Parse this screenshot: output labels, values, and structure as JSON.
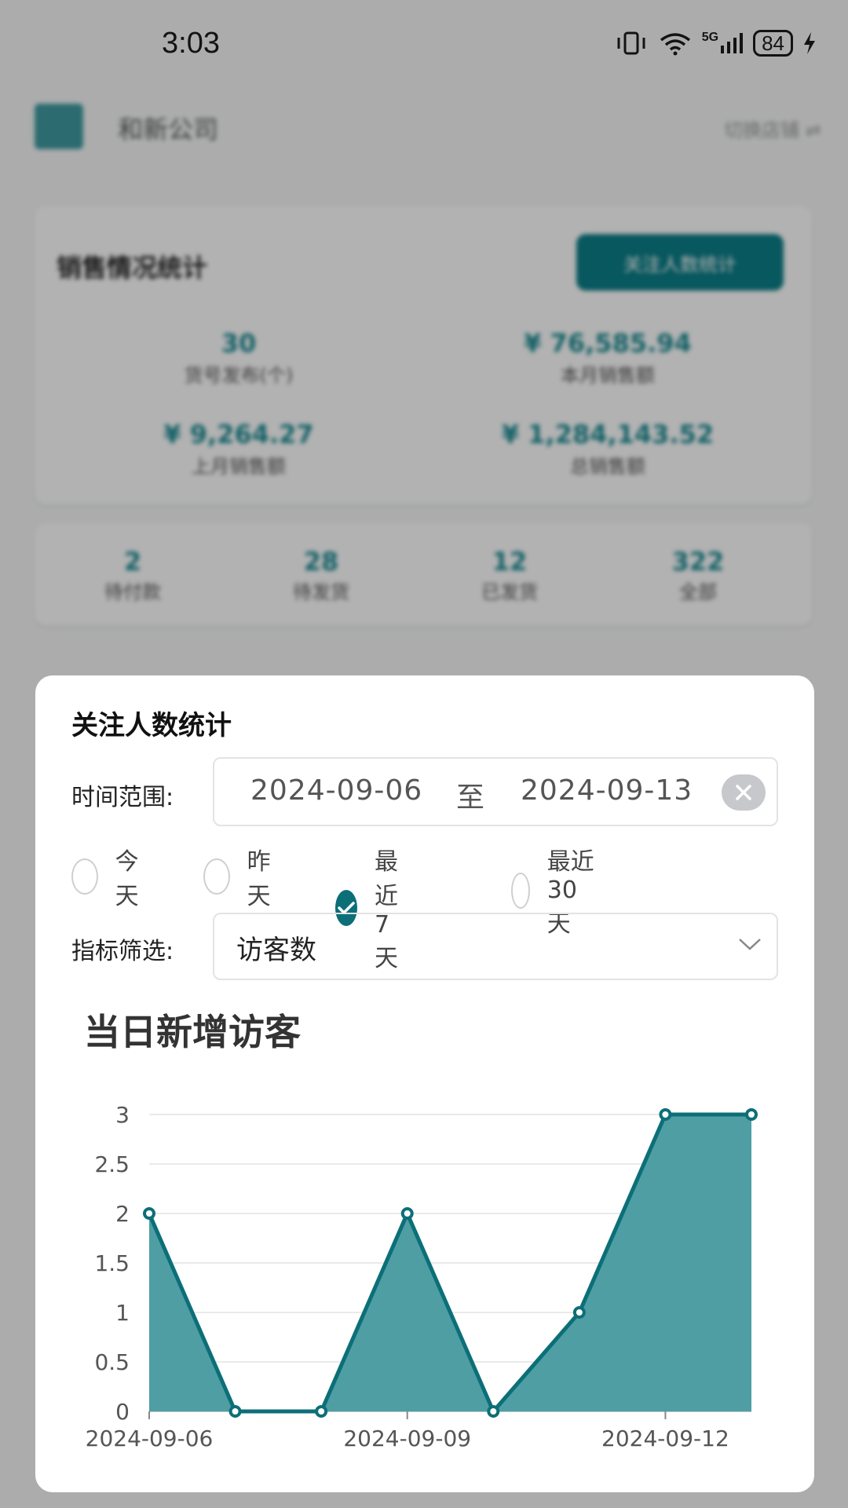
{
  "status_bar": {
    "time": "3:03",
    "battery": "84",
    "network": "5G"
  },
  "background": {
    "company_name": "和新公司",
    "header_right": "切换店铺 ⇌",
    "sales_card": {
      "title": "销售情况统计",
      "button": "关注人数统计",
      "stats": [
        {
          "value": "30",
          "label": "货号发布(个)"
        },
        {
          "value": "¥ 76,585.94",
          "label": "本月销售额"
        },
        {
          "value": "¥ 9,264.27",
          "label": "上月销售额"
        },
        {
          "value": "¥ 1,284,143.52",
          "label": "总销售额"
        }
      ]
    },
    "order_card": {
      "stats": [
        {
          "value": "2",
          "label": "待付款"
        },
        {
          "value": "28",
          "label": "待发货"
        },
        {
          "value": "12",
          "label": "已发货"
        },
        {
          "value": "322",
          "label": "全部"
        }
      ]
    }
  },
  "modal": {
    "title": "关注人数统计",
    "time_range_label": "时间范围:",
    "date_start": "2024-09-06",
    "date_to": "至",
    "date_end": "2024-09-13",
    "quick_ranges": [
      {
        "label": "今天",
        "checked": false
      },
      {
        "label": "昨天",
        "checked": false
      },
      {
        "label": "最近7天",
        "checked": true
      },
      {
        "label": "最近30天",
        "checked": false
      }
    ],
    "metric_label": "指标筛选:",
    "metric_value": "访客数",
    "accent_color": "#0c6f78"
  },
  "chart_data": {
    "type": "area",
    "title": "当日新增访客",
    "x": [
      "2024-09-06",
      "2024-09-07",
      "2024-09-08",
      "2024-09-09",
      "2024-09-10",
      "2024-09-11",
      "2024-09-12",
      "2024-09-13"
    ],
    "values": [
      2,
      0,
      0,
      2,
      0,
      1,
      3,
      3
    ],
    "x_tick_labels": [
      "2024-09-06",
      "2024-09-09",
      "2024-09-12"
    ],
    "y_ticks": [
      "0",
      "0.5",
      "1",
      "1.5",
      "2",
      "2.5",
      "3"
    ],
    "ylim": [
      0,
      3
    ],
    "grid": true,
    "line_color": "#0c6f78",
    "fill_color": "#4e9ea4"
  }
}
